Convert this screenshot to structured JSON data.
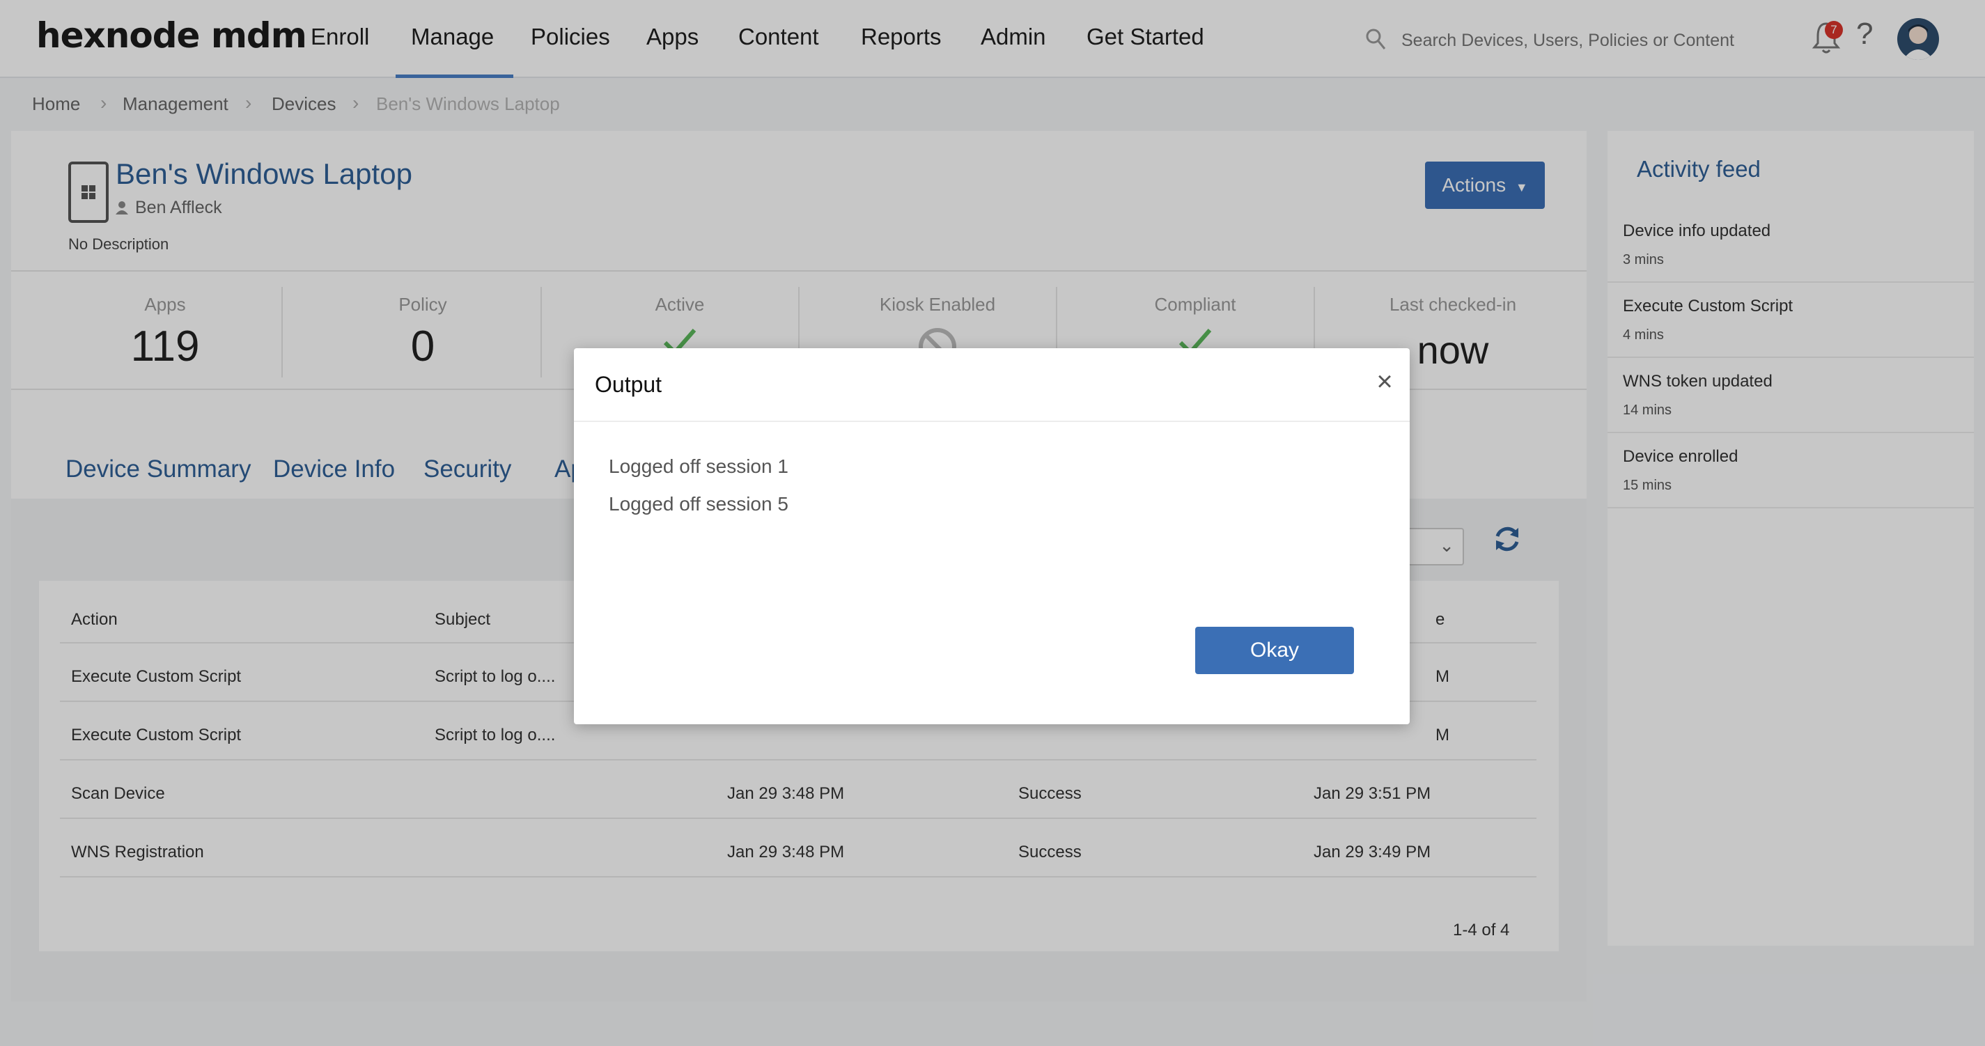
{
  "brand": {
    "logo": "hexnode mdm"
  },
  "nav": {
    "items": [
      "Enroll",
      "Manage",
      "Policies",
      "Apps",
      "Content",
      "Reports",
      "Admin",
      "Get Started"
    ],
    "active": "Manage"
  },
  "search": {
    "placeholder": "Search Devices, Users, Policies or Content"
  },
  "notifications": {
    "count": "7"
  },
  "help": {
    "label": "?"
  },
  "breadcrumb": [
    "Home",
    "Management",
    "Devices",
    "Ben's Windows Laptop"
  ],
  "device": {
    "name": "Ben's Windows Laptop",
    "owner": "Ben Affleck",
    "description": "No Description",
    "actions_label": "Actions"
  },
  "stats": [
    {
      "label": "Apps",
      "value": "119"
    },
    {
      "label": "Policy",
      "value": "0"
    },
    {
      "label": "Active",
      "value": ""
    },
    {
      "label": "Kiosk Enabled",
      "value": ""
    },
    {
      "label": "Compliant",
      "value": ""
    },
    {
      "label": "Last checked-in",
      "value": "now"
    }
  ],
  "tabs": [
    "Device Summary",
    "Device Info",
    "Security",
    "Ap"
  ],
  "table": {
    "headers": [
      "Action",
      "Subject",
      "e"
    ],
    "rows": [
      {
        "action": "Execute Custom Script",
        "subject": "Script to log o....",
        "created": "",
        "status": "",
        "output": "",
        "updated": "M"
      },
      {
        "action": "Execute Custom Script",
        "subject": "Script to log o....",
        "created": "",
        "status": "",
        "output": "",
        "updated": "M"
      },
      {
        "action": "Scan Device",
        "subject": "",
        "created": "Jan 29 3:48 PM",
        "status": "Success",
        "output": "",
        "updated": "Jan 29 3:51 PM"
      },
      {
        "action": "WNS Registration",
        "subject": "",
        "created": "Jan 29 3:48 PM",
        "status": "Success",
        "output": "",
        "updated": "Jan 29 3:49 PM"
      }
    ],
    "pagination": "1-4 of 4"
  },
  "activity_feed": {
    "title": "Activity feed",
    "items": [
      {
        "name": "Device info updated",
        "time": "3 mins"
      },
      {
        "name": "Execute Custom Script",
        "time": "4 mins"
      },
      {
        "name": "WNS token updated",
        "time": "14 mins"
      },
      {
        "name": "Device enrolled",
        "time": "15 mins"
      }
    ]
  },
  "modal": {
    "title": "Output",
    "close": "×",
    "lines": [
      "Logged off session 1",
      "Logged off session 5"
    ],
    "okay_label": "Okay"
  },
  "colors": {
    "accent": "#3b6fb5",
    "link": "#2f5f96",
    "success": "#5cb85c",
    "badge": "#d9342b"
  },
  "icons": [
    "search-icon",
    "bell-icon",
    "help-icon",
    "avatar",
    "windows-device-icon",
    "user-icon",
    "check-icon",
    "ban-icon",
    "refresh-icon",
    "caret-down-icon",
    "close-icon"
  ]
}
